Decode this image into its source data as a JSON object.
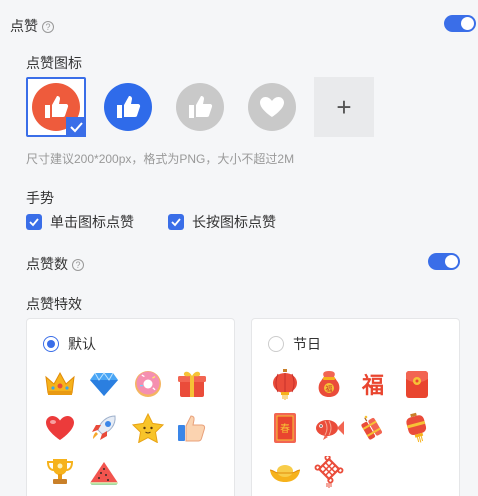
{
  "like_section": {
    "title": "点赞",
    "help": "?",
    "enabled": true
  },
  "like_icon": {
    "title": "点赞图标",
    "options": [
      {
        "name": "thumb-orange",
        "color": "#ee5b3c",
        "selected": true
      },
      {
        "name": "thumb-blue",
        "color": "#2f6bea",
        "selected": false
      },
      {
        "name": "thumb-gray",
        "color": "#c9c9c9",
        "selected": false
      },
      {
        "name": "heart-gray",
        "color": "#c9c9c9",
        "selected": false
      }
    ],
    "add_label": "+",
    "hint": "尺寸建议200*200px，格式为PNG，大小不超过2M"
  },
  "gesture": {
    "title": "手势",
    "options": [
      {
        "label": "单击图标点赞",
        "checked": true
      },
      {
        "label": "长按图标点赞",
        "checked": true
      }
    ]
  },
  "like_count": {
    "title": "点赞数",
    "help": "?",
    "enabled": true
  },
  "effect": {
    "title": "点赞特效",
    "cards": [
      {
        "label": "默认",
        "selected": true,
        "icons": [
          "crown-icon",
          "diamond-icon",
          "donut-icon",
          "gift-icon",
          "heart-icon",
          "rocket-icon",
          "star-icon",
          "thumbs-up-icon",
          "trophy-icon",
          "watermelon-icon"
        ]
      },
      {
        "label": "节日",
        "selected": false,
        "icons": [
          "lantern-icon",
          "lucky-bag-icon",
          "fu-character-icon",
          "red-envelope-icon",
          "spring-couplet-icon",
          "koi-fish-icon",
          "firecracker-icon",
          "festival-lantern-icon",
          "gold-ingot-icon",
          "chinese-knot-icon"
        ]
      }
    ]
  },
  "colors": {
    "accent": "#3a6ee8"
  }
}
